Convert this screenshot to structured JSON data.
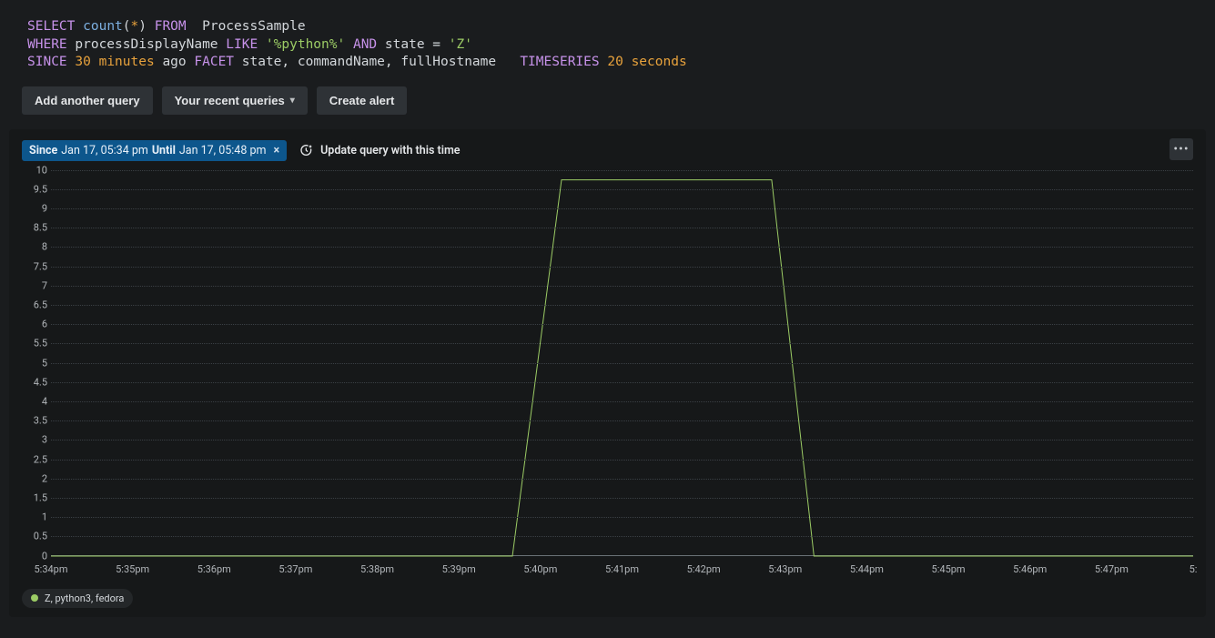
{
  "query": {
    "select": "SELECT",
    "count": "count",
    "star": "*",
    "from": "FROM",
    "table": "ProcessSample",
    "where": "WHERE",
    "field1": "processDisplayName",
    "like": "LIKE",
    "str1": "'%python%'",
    "and": "AND",
    "field2": "state",
    "eq": "=",
    "str2": "'Z'",
    "since": "SINCE",
    "num_since": "30",
    "unit_since": "minutes",
    "ago": "ago",
    "facet": "FACET",
    "facets": "state, commandName, fullHostname",
    "timeseries": "TIMESERIES",
    "num_ts": "20",
    "unit_ts": "seconds"
  },
  "toolbar": {
    "add_query": "Add another query",
    "recent": "Your recent queries",
    "create_alert": "Create alert"
  },
  "time_range": {
    "since_label": "Since",
    "since_value": "Jan 17, 05:34 pm",
    "until_label": "Until",
    "until_value": "Jan 17, 05:48 pm"
  },
  "update_time_label": "Update query with this time",
  "chart_data": {
    "type": "line",
    "ylim": [
      0,
      10
    ],
    "y_ticks": [
      0,
      0.5,
      1,
      1.5,
      2,
      2.5,
      3,
      3.5,
      4,
      4.5,
      5,
      5.5,
      6,
      6.5,
      7,
      7.5,
      8,
      8.5,
      9,
      9.5,
      10
    ],
    "x_ticks": [
      "5:34pm",
      "5:35pm",
      "5:36pm",
      "5:37pm",
      "5:38pm",
      "5:39pm",
      "5:40pm",
      "5:41pm",
      "5:42pm",
      "5:43pm",
      "5:44pm",
      "5:45pm",
      "5:46pm",
      "5:47pm",
      "5:"
    ],
    "series": [
      {
        "name": "Z, python3, fedora",
        "color": "#9ccc65",
        "points": [
          {
            "x": 0.0,
            "y": 0
          },
          {
            "x": 40.4,
            "y": 0
          },
          {
            "x": 44.7,
            "y": 9.75
          },
          {
            "x": 63.1,
            "y": 9.75
          },
          {
            "x": 66.8,
            "y": 0
          },
          {
            "x": 100.0,
            "y": 0
          }
        ]
      }
    ]
  },
  "legend_text": "Z, python3, fedora"
}
